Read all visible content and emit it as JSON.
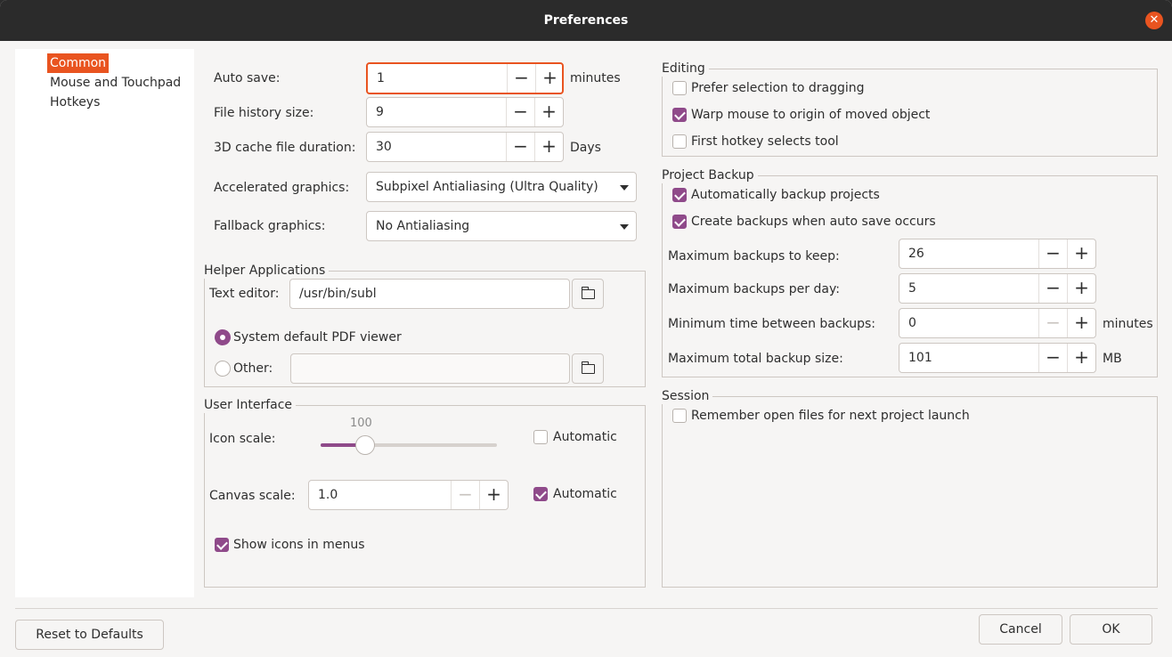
{
  "window": {
    "title": "Preferences"
  },
  "sidebar": {
    "items": [
      {
        "label": "Common"
      },
      {
        "label": "Mouse and Touchpad"
      },
      {
        "label": "Hotkeys"
      }
    ]
  },
  "general": {
    "auto_save_label": "Auto save:",
    "auto_save_value": "1",
    "auto_save_unit": "minutes",
    "file_history_label": "File history size:",
    "file_history_value": "9",
    "cache_label": "3D cache file duration:",
    "cache_value": "30",
    "cache_unit": "Days",
    "accel_label": "Accelerated graphics:",
    "accel_value": "Subpixel Antialiasing (Ultra Quality)",
    "fallback_label": "Fallback graphics:",
    "fallback_value": "No Antialiasing"
  },
  "helper": {
    "title": "Helper Applications",
    "text_editor_label": "Text editor:",
    "text_editor_value": "/usr/bin/subl",
    "pdf_default_label": "System default PDF viewer",
    "pdf_other_label": "Other:",
    "pdf_other_value": ""
  },
  "ui": {
    "title": "User Interface",
    "icon_scale_label": "Icon scale:",
    "icon_scale_value": "100",
    "icon_scale_fraction": 0.25,
    "icon_auto_label": "Automatic",
    "canvas_scale_label": "Canvas scale:",
    "canvas_scale_value": "1.0",
    "canvas_auto_label": "Automatic",
    "show_icons_label": "Show icons in menus"
  },
  "editing": {
    "title": "Editing",
    "prefer_selection": "Prefer selection to dragging",
    "warp_mouse": "Warp mouse to origin of moved object",
    "first_hotkey": "First hotkey selects tool"
  },
  "backup": {
    "title": "Project Backup",
    "auto_backup": "Automatically backup projects",
    "backup_on_save": "Create backups when auto save occurs",
    "max_keep_label": "Maximum backups to keep:",
    "max_keep_value": "26",
    "per_day_label": "Maximum backups per day:",
    "per_day_value": "5",
    "min_time_label": "Minimum time between backups:",
    "min_time_value": "0",
    "min_time_unit": "minutes",
    "max_size_label": "Maximum total backup size:",
    "max_size_value": "101",
    "max_size_unit": "MB"
  },
  "session": {
    "title": "Session",
    "remember_files": "Remember open files for next project launch"
  },
  "buttons": {
    "reset": "Reset to Defaults",
    "cancel": "Cancel",
    "ok": "OK"
  },
  "symbols": {
    "minus": "−",
    "plus": "+",
    "close": "✕"
  },
  "colors": {
    "accent": "#e95420",
    "check": "#8f4a8a",
    "titlebar": "#2b2b2b"
  }
}
